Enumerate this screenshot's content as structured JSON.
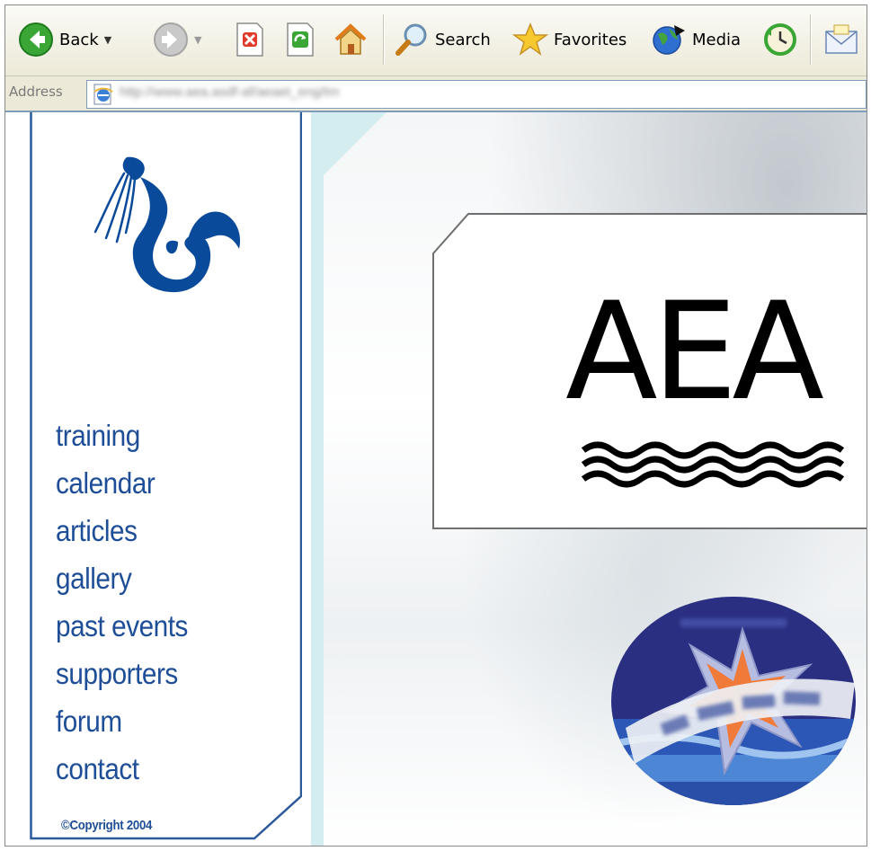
{
  "toolbar": {
    "back_label": "Back",
    "search_label": "Search",
    "favorites_label": "Favorites",
    "media_label": "Media"
  },
  "address": {
    "label": "Address",
    "url": "http://www.aea.asdf-af/aeaet_eng/tm"
  },
  "nav": {
    "items": [
      "training",
      "calendar",
      "articles",
      "gallery",
      "past events",
      "supporters",
      "forum",
      "contact"
    ]
  },
  "footer": {
    "copyright": "©Copyright 2004"
  },
  "banner": {
    "logo_text": "AEA"
  },
  "colors": {
    "nav_blue": "#1e4e97",
    "mermaid_blue": "#0a4a9a",
    "sidebar_border": "#2c5a9a",
    "strip_cyan": "#d3edf0"
  }
}
